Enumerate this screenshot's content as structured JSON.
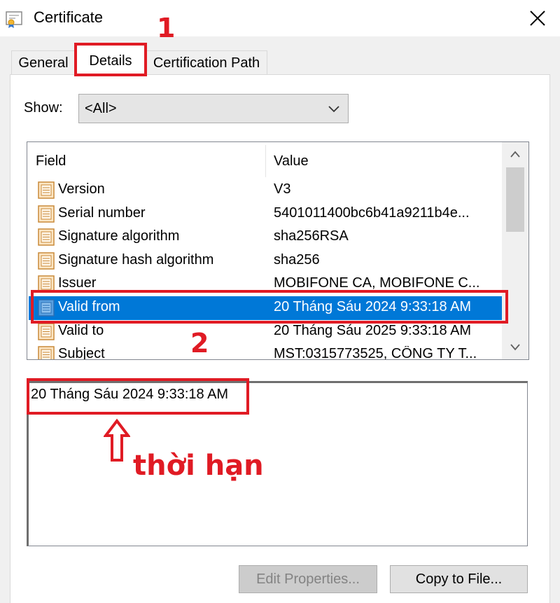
{
  "window": {
    "title": "Certificate"
  },
  "tabs": [
    {
      "label": "General"
    },
    {
      "label": "Details"
    },
    {
      "label": "Certification Path"
    }
  ],
  "show": {
    "label": "Show:",
    "value": "<All>"
  },
  "list": {
    "columns": {
      "field": "Field",
      "value": "Value"
    },
    "rows": [
      {
        "field": "Version",
        "value": "V3"
      },
      {
        "field": "Serial number",
        "value": "5401011400bc6b41a9211b4e..."
      },
      {
        "field": "Signature algorithm",
        "value": "sha256RSA"
      },
      {
        "field": "Signature hash algorithm",
        "value": "sha256"
      },
      {
        "field": "Issuer",
        "value": "MOBIFONE CA, MOBIFONE C..."
      },
      {
        "field": "Valid from",
        "value": "20 Tháng Sáu 2024 9:33:18 AM"
      },
      {
        "field": "Valid to",
        "value": "20 Tháng Sáu 2025 9:33:18 AM"
      },
      {
        "field": "Subject",
        "value": "MST:0315773525, CÔNG TY T..."
      }
    ],
    "selected_index": 5
  },
  "detail": {
    "text": "20 Tháng Sáu 2024 9:33:18 AM"
  },
  "buttons": {
    "edit": "Edit Properties...",
    "copy": "Copy to File..."
  },
  "annotations": {
    "step1": "1",
    "step2": "2",
    "arrow_label": "thời hạn"
  },
  "colors": {
    "highlight": "#e01b24",
    "selection": "#0078d7"
  }
}
